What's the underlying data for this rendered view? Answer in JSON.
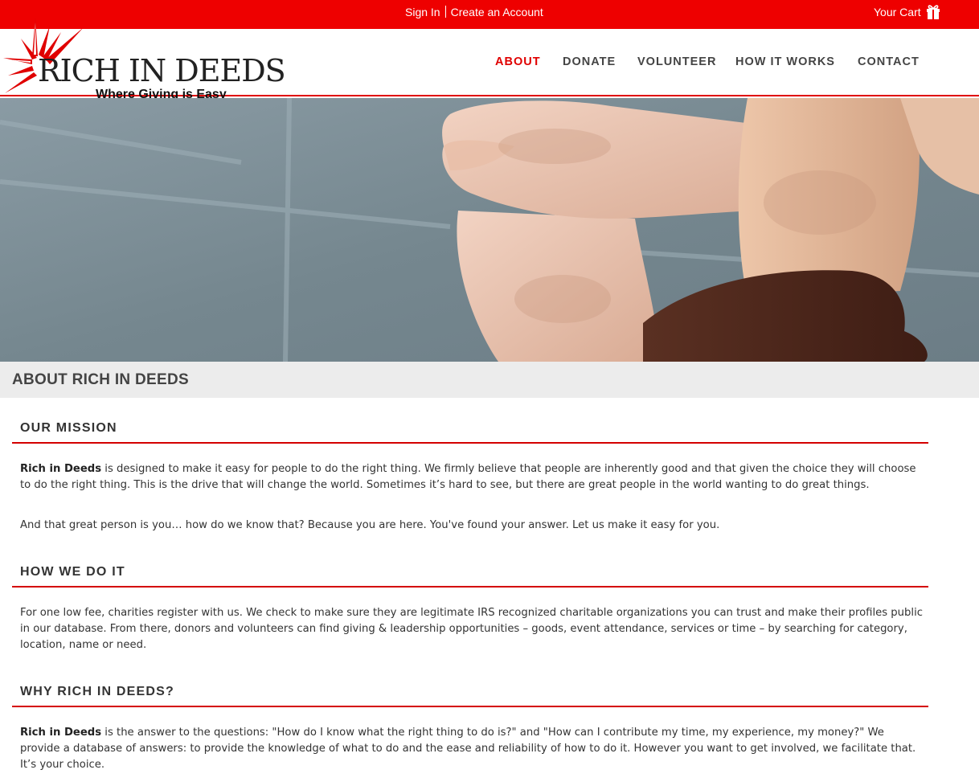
{
  "topbar": {
    "sign_in": "Sign In",
    "create_account": "Create an Account",
    "cart": "Your Cart",
    "bg_color": "#ee0000"
  },
  "logo": {
    "title": "RICH IN DEEDS",
    "tagline": "Where Giving is Easy"
  },
  "nav": {
    "items": [
      {
        "label": "ABOUT",
        "active": true
      },
      {
        "label": "DONATE"
      },
      {
        "label": "VOLUNTEER"
      },
      {
        "label": "HOW IT WORKS"
      },
      {
        "label": "CONTACT"
      }
    ],
    "active_color": "#e00000"
  },
  "page": {
    "heading": "ABOUT RICH IN DEEDS"
  },
  "sections": [
    {
      "title": "OUR MISSION",
      "paragraphs": [
        {
          "bold": "Rich in Deeds",
          "text": " is designed to make it easy for people to do the right thing. We firmly believe that people are inherently good and that given the choice they will choose to do the right thing. This is the drive that will change the world. Sometimes it’s hard to see, but there are great people in the world wanting to do great things."
        },
        {
          "bold": "",
          "text": "And that great person is you… how do we know that? Because you are here. You've found your answer. Let us make it easy for you."
        }
      ]
    },
    {
      "title": "HOW WE DO IT",
      "paragraphs": [
        {
          "bold": "",
          "text": "For one low fee, charities register with us. We check to make sure they are legitimate IRS recognized charitable organizations you can trust and make their profiles public in our database. From there, donors and volunteers can find giving & leadership opportunities – goods, event attendance, services or time – by searching for category, location, name or need."
        }
      ]
    },
    {
      "title": "WHY RICH IN DEEDS?",
      "paragraphs": [
        {
          "bold": "Rich in Deeds",
          "text": " is the answer to the questions: \"How do I know what the right thing to do is?\" and \"How can I contribute my time, my experience, my money?\" We provide a database of answers: to provide the knowledge of what to do and the ease and reliability of how to do it. However you want to get involved, we facilitate that. It’s your choice."
        }
      ]
    }
  ]
}
